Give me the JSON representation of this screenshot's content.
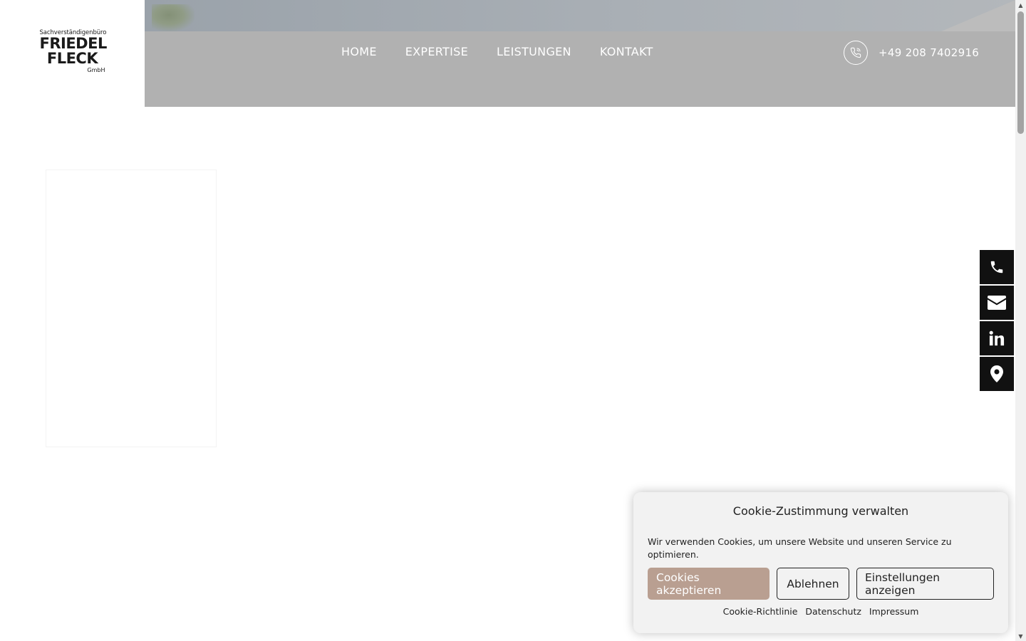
{
  "logo": {
    "top_text": "Sachverständigenbüro",
    "line1": "FRIEDEL",
    "line2": "FLECK",
    "suffix": "GmbH"
  },
  "nav": {
    "items": [
      {
        "label": "HOME"
      },
      {
        "label": "EXPERTISE"
      },
      {
        "label": "LEISTUNGEN"
      },
      {
        "label": "KONTAKT"
      }
    ]
  },
  "header": {
    "phone": "+49 208 7402916"
  },
  "side_bar": {
    "icons": [
      "phone-icon",
      "envelope-icon",
      "linkedin-icon",
      "map-pin-icon"
    ]
  },
  "cookie": {
    "title": "Cookie-Zustimmung verwalten",
    "text": "Wir verwenden Cookies, um unsere Website und unseren Service zu optimieren.",
    "accept_label": "Cookies akzeptieren",
    "reject_label": "Ablehnen",
    "settings_label": "Einstellungen anzeigen",
    "links": [
      {
        "label": "Cookie-Richtlinie"
      },
      {
        "label": "Datenschutz"
      },
      {
        "label": "Impressum"
      }
    ]
  },
  "colors": {
    "header_bg": "#b1b1b1",
    "accent": "#b99f91",
    "side_bar_bg": "#111111",
    "cookie_bg": "#f2f2f2"
  }
}
